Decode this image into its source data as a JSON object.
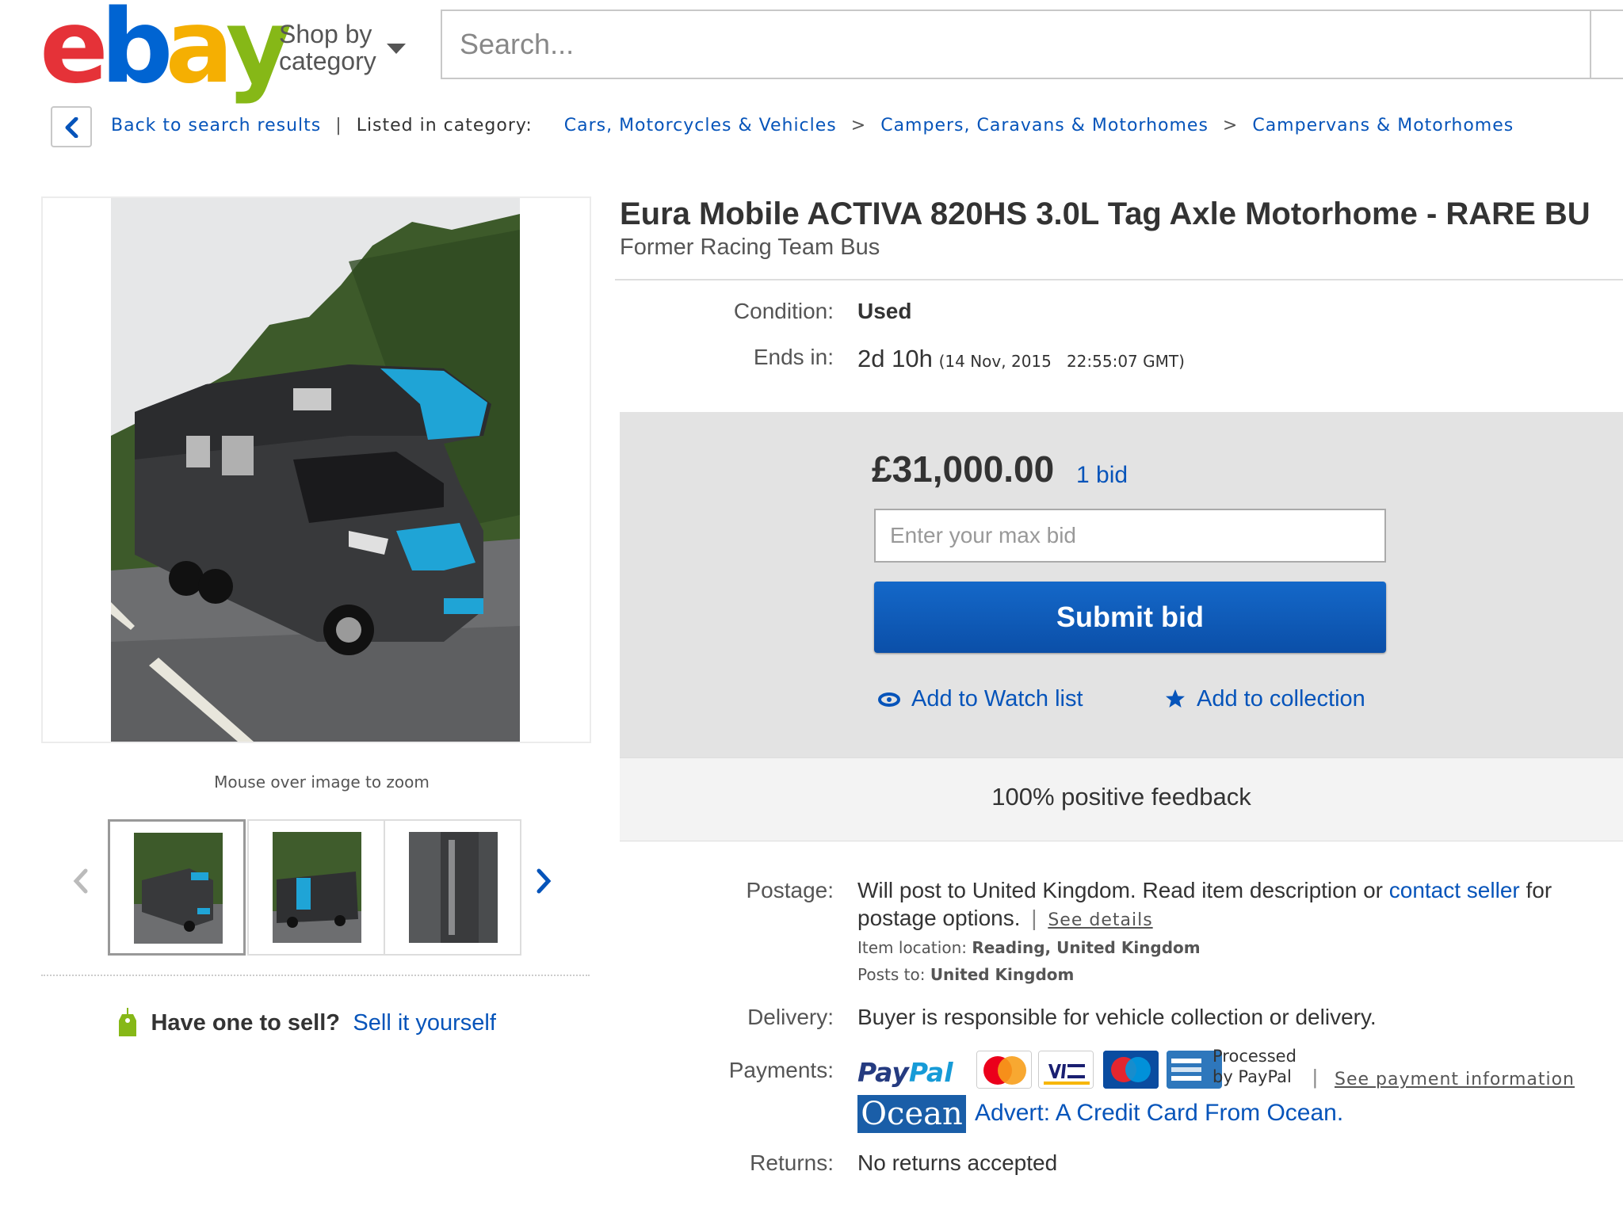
{
  "header": {
    "logo": {
      "letters": [
        "e",
        "b",
        "a",
        "y"
      ],
      "colors": [
        "#e53238",
        "#0064d2",
        "#f5af02",
        "#86b817"
      ]
    },
    "shop_by": "Shop by",
    "category": "category",
    "search_placeholder": "Search..."
  },
  "breadcrumb": {
    "back": "Back to search results",
    "divider": "|",
    "listed_in": "Listed in category:",
    "cat1": "Cars, Motorcycles & Vehicles",
    "cat2": "Campers, Caravans & Motorhomes",
    "cat3": "Campervans & Motorhomes",
    "sep": ">"
  },
  "gallery": {
    "zoom_hint": "Mouse over image to zoom",
    "thumbnail_count": 3,
    "selected_thumbnail": 1
  },
  "sell": {
    "question": "Have one to sell?",
    "link": "Sell it yourself"
  },
  "item": {
    "title": "Eura Mobile ACTIVA 820HS 3.0L Tag Axle Motorhome - RARE BU",
    "subtitle": "Former Racing Team Bus",
    "condition_label": "Condition:",
    "condition": "Used",
    "ends_label": "Ends in:",
    "ends_in": "2d 10h",
    "ends_date": "(14 Nov, 2015   22:55:07 GMT)"
  },
  "bid": {
    "price": "£31,000.00",
    "bids": "1 bid",
    "max_bid_placeholder": "Enter your max bid",
    "submit": "Submit bid",
    "watch": "Add to Watch list",
    "collection": "Add to collection",
    "feedback": "100% positive feedback"
  },
  "postage": {
    "label": "Postage:",
    "line1_a": "Will post to United Kingdom. Read item description or",
    "contact": "contact seller",
    "line1_b": "for",
    "line2": "postage options.",
    "pipe": "|",
    "see_details": "See details",
    "location_label": "Item location:",
    "location": "Reading, United Kingdom",
    "posts_label": "Posts to:",
    "posts_to": "United Kingdom"
  },
  "delivery": {
    "label": "Delivery:",
    "text": "Buyer is responsible for vehicle collection or delivery."
  },
  "payments": {
    "label": "Payments:",
    "paypal_a": "Pay",
    "paypal_b": "Pal",
    "cards": [
      "MasterCard",
      "VISA",
      "Maestro",
      "American Express"
    ],
    "processed_1": "Processed",
    "processed_2": "by PayPal",
    "pipe": "|",
    "see_payment": "See payment information",
    "ocean": "Ocean",
    "advert": "Advert: A Credit Card From Ocean."
  },
  "returns": {
    "label": "Returns:",
    "text": "No returns accepted"
  }
}
